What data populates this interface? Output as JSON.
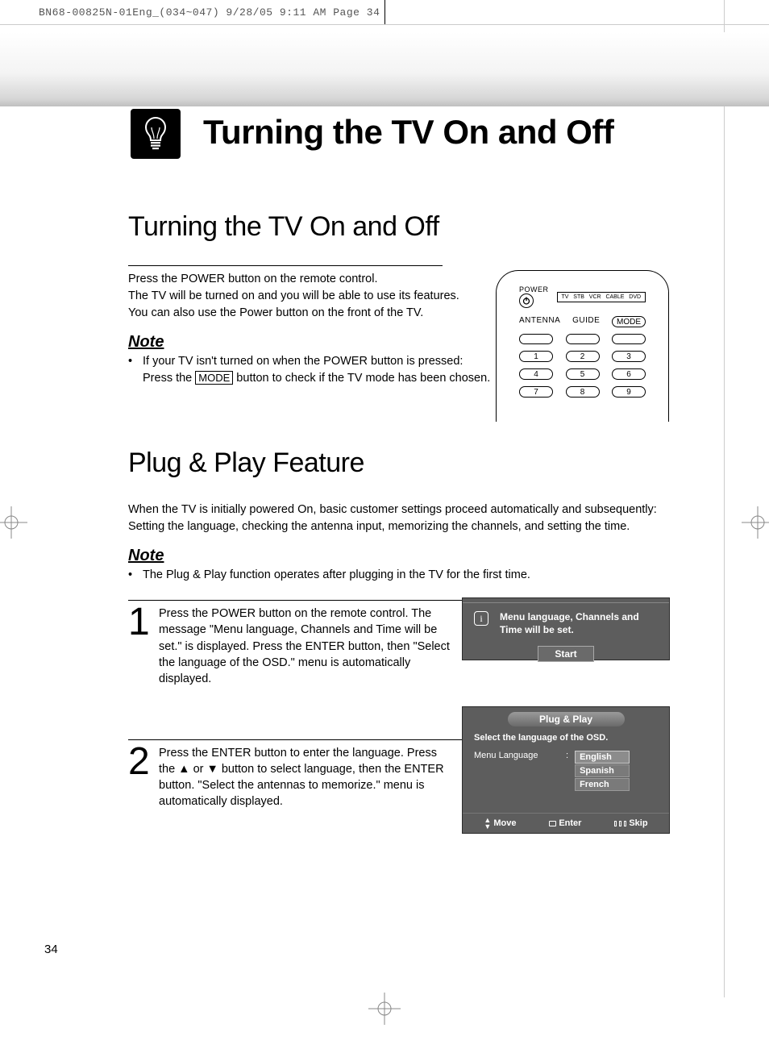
{
  "slug": "BN68-00825N-01Eng_(034~047)  9/28/05  9:11 AM  Page 34",
  "title": "Turning the TV On and Off",
  "section1": {
    "heading": "Turning the TV On and Off",
    "line1": "Press the POWER button on the remote control.",
    "line2": "The TV will be turned on and you will be able to use its features.",
    "line3": "You can also use the Power button on the front of the TV.",
    "note_h": "Note",
    "note_bullet_a": "If your TV isn't turned on when the POWER button is pressed:",
    "note_bullet_b1": "Press the ",
    "note_bullet_box": "MODE",
    "note_bullet_b2": " button to check if the TV mode has been chosen."
  },
  "remote": {
    "power": "POWER",
    "mini": [
      "TV",
      "STB",
      "VCR",
      "CABLE",
      "DVD"
    ],
    "col1": "ANTENNA",
    "col2": "GUIDE",
    "col3": "MODE",
    "nums": [
      "1",
      "2",
      "3",
      "4",
      "5",
      "6",
      "7",
      "8",
      "9"
    ]
  },
  "section2": {
    "heading": "Plug & Play Feature",
    "intro1": "When the TV is initially powered On, basic customer settings proceed automatically and subsequently:",
    "intro2": "Setting the language, checking the antenna input, memorizing the channels, and setting the time.",
    "note_h": "Note",
    "note_bullet": "The Plug & Play function operates after plugging in the TV for the first time.",
    "step1_num": "1",
    "step1": "Press the POWER button on the remote control. The message \"Menu language, Channels and Time will be set.\" is displayed.\nPress the ENTER button, then \"Select the language of the OSD.\" menu is automatically displayed.",
    "step2_num": "2",
    "step2": "Press the ENTER button to enter the language. Press the ▲ or ▼ button to select language, then the ENTER button. \"Select the antennas to memorize.\" menu is automatically displayed."
  },
  "osd1": {
    "msg": "Menu language, Channels and Time will be set.",
    "btn": "Start"
  },
  "osd2": {
    "title": "Plug & Play",
    "sub": "Select the language of the OSD.",
    "label": "Menu Language",
    "opts": [
      "English",
      "Spanish",
      "French"
    ],
    "move": "Move",
    "enter": "Enter",
    "skip": "Skip"
  },
  "page": "34"
}
